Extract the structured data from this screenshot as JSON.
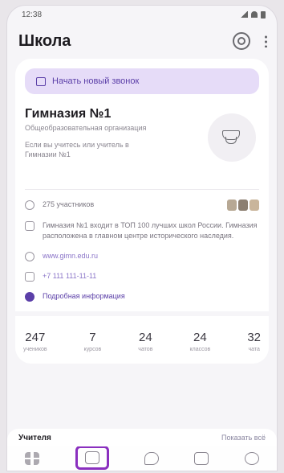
{
  "status": {
    "time": "12:38"
  },
  "header": {
    "title": "Школа"
  },
  "start_chat": {
    "label": "Начать новый звонок"
  },
  "school": {
    "name": "Гимназия №1",
    "subtitle": "Общеобразовательная организация",
    "description": "Если вы учитесь или учитель в Гимназии №1"
  },
  "info": {
    "members": "275 участников",
    "about": "Гимназия №1 входит в ТОП 100 лучших школ России. Гимназия расположена в главном центре исторического наследия.",
    "website": "www.gimn.edu.ru",
    "phone": "+7 111 111-11-11",
    "more": "Подробная информация"
  },
  "stats": [
    {
      "num": "247",
      "label": "учеников"
    },
    {
      "num": "7",
      "label": "курсов"
    },
    {
      "num": "24",
      "label": "чатов"
    },
    {
      "num": "24",
      "label": "классов"
    },
    {
      "num": "32",
      "label": "чата"
    }
  ],
  "teachers": {
    "title": "Учителя",
    "link": "Показать всё"
  },
  "colors": {
    "accent": "#5b3fa8",
    "highlight": "#8a2fbf",
    "button_bg": "#e6dcf8"
  }
}
